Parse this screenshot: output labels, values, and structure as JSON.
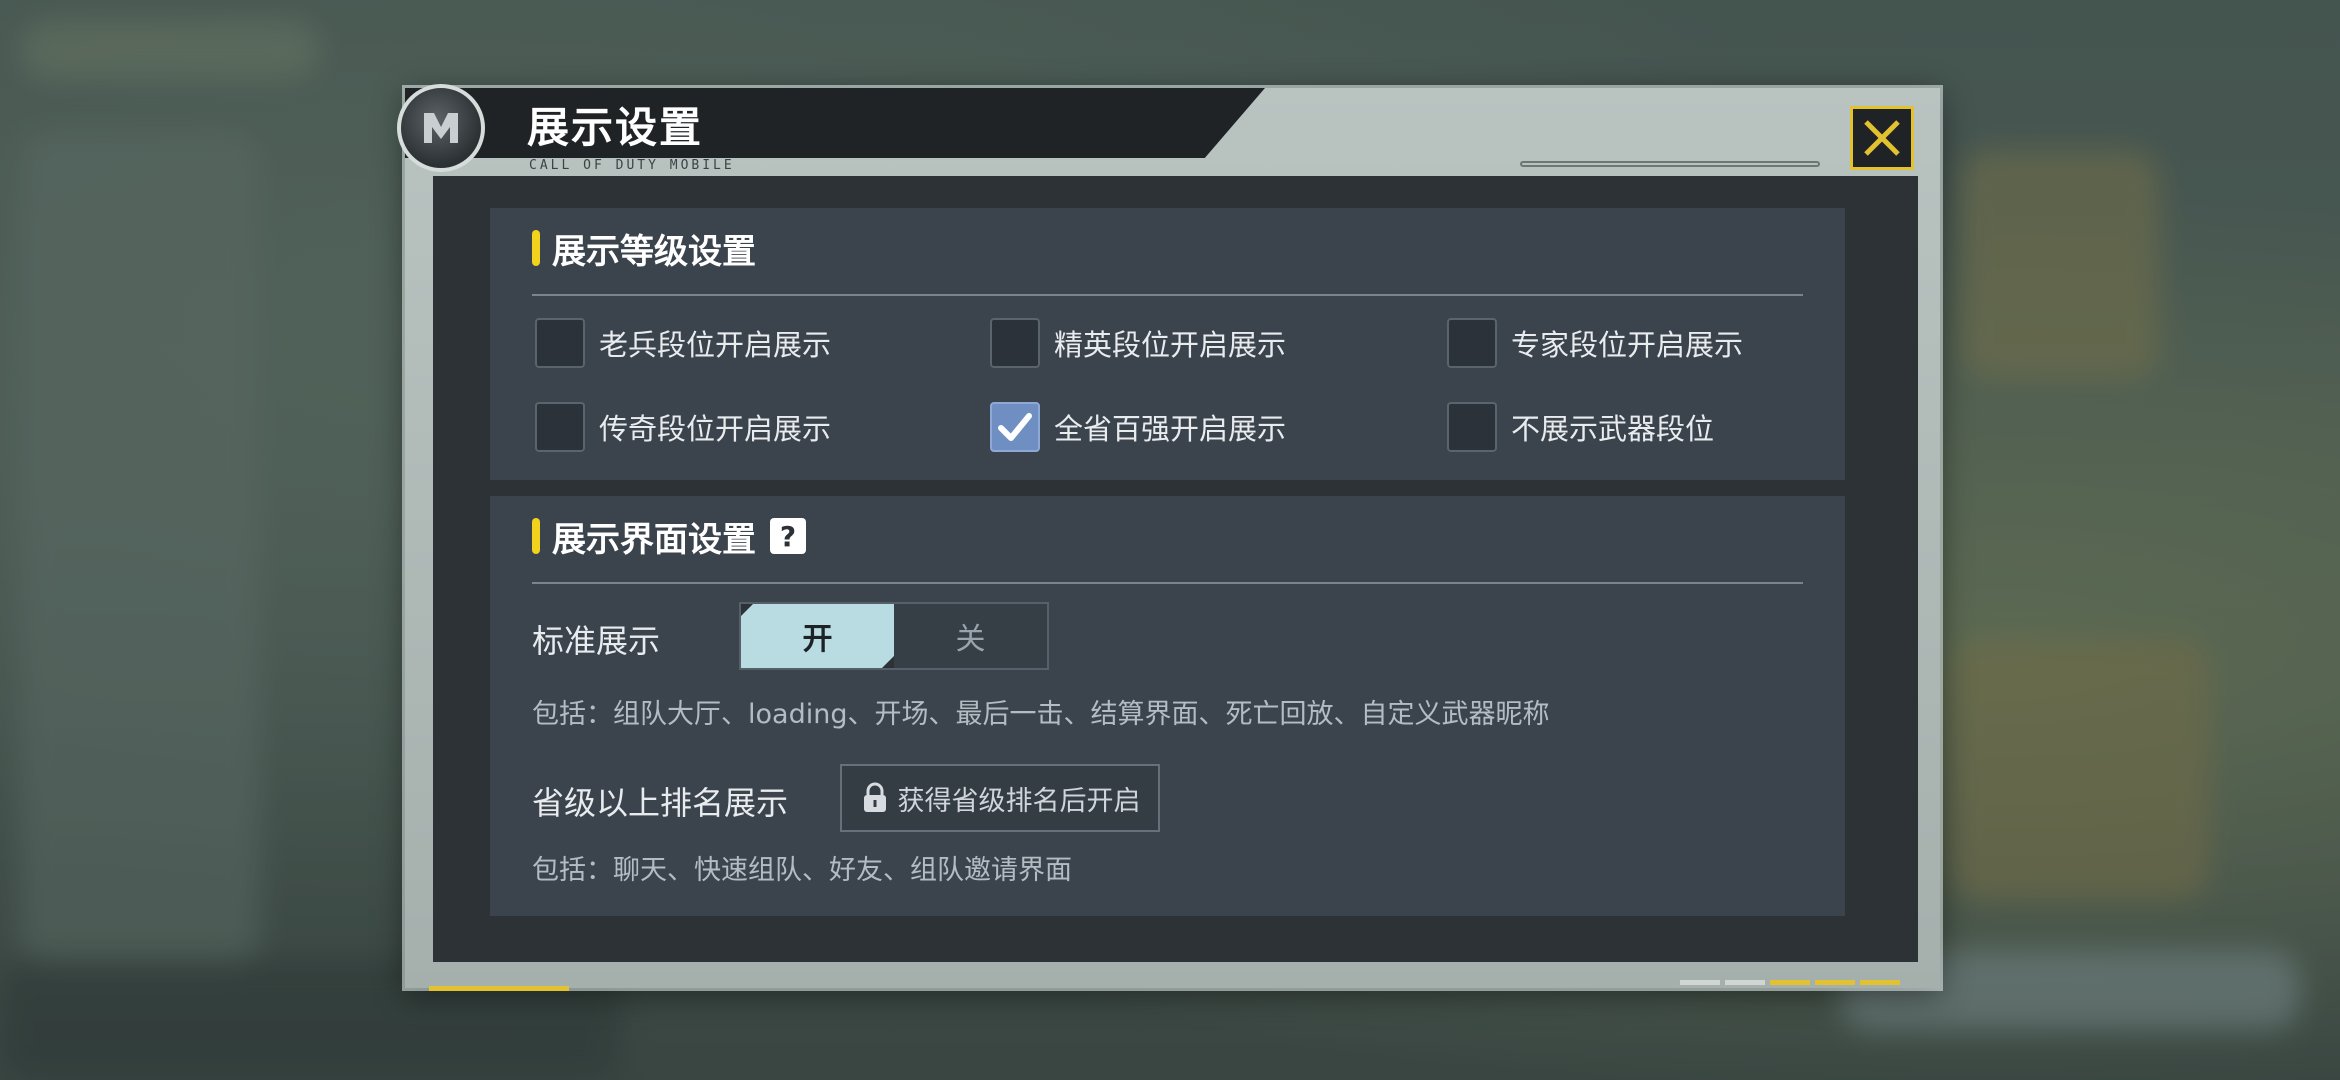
{
  "dialog": {
    "title": "展示设置",
    "subtitle": "CALL OF DUTY MOBILE"
  },
  "level_section": {
    "title": "展示等级设置",
    "options": [
      {
        "label": "老兵段位开启展示",
        "checked": false
      },
      {
        "label": "精英段位开启展示",
        "checked": false
      },
      {
        "label": "专家段位开启展示",
        "checked": false
      },
      {
        "label": "传奇段位开启展示",
        "checked": false
      },
      {
        "label": "全省百强开启展示",
        "checked": true
      },
      {
        "label": "不展示武器段位",
        "checked": false
      }
    ]
  },
  "interface_section": {
    "title": "展示界面设置",
    "help_glyph": "?",
    "standard": {
      "label": "标准展示",
      "on_label": "开",
      "off_label": "关",
      "selected": "on",
      "description": "包括：组队大厅、loading、开场、最后一击、结算界面、死亡回放、自定义武器昵称"
    },
    "provincial": {
      "label": "省级以上排名展示",
      "locked_button": "获得省级排名后开启",
      "description": "包括：聊天、快速组队、好友、组队邀请界面"
    }
  },
  "icons": {
    "close": "close-x-icon",
    "emblem": "codm-logo-icon",
    "lock": "lock-icon",
    "check": "checkmark-icon"
  },
  "colors": {
    "accent_yellow": "#e3c232",
    "toggle_on": "#b9dbe2",
    "checked_box": "#6f8fc2"
  }
}
